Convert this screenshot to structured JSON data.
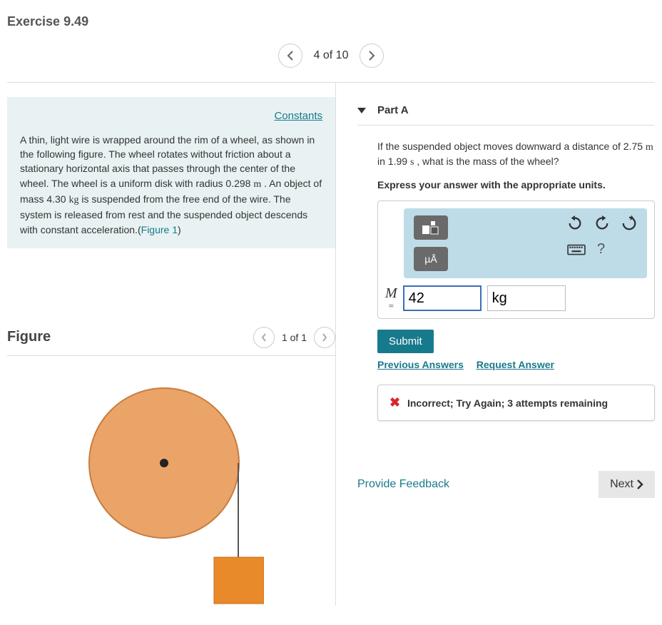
{
  "header": {
    "title": "Exercise 9.49"
  },
  "nav": {
    "position": "4 of 10"
  },
  "problem": {
    "constants_link": "Constants",
    "text_1": "A thin, light wire is wrapped around the rim of a wheel, as shown in the following figure. The wheel rotates without friction about a stationary horizontal axis that passes through the center of the wheel. The wheel is a uniform disk with radius 0.298 ",
    "unit_m1": "m",
    "text_2": " . An object of mass 4.30 ",
    "unit_kg": "kg",
    "text_3": " is suspended from the free end of the wire. The system is released from rest and the suspended object descends with constant acceleration.(",
    "figure_link": "Figure 1",
    "text_4": ")"
  },
  "figure": {
    "heading": "Figure",
    "position": "1 of 1"
  },
  "part": {
    "label": "Part A",
    "question_1": "If the suspended object moves downward a distance of 2.75 ",
    "q_unit_m": "m",
    "question_2": " in 1.99 ",
    "q_unit_s": "s",
    "question_3": " , what is the mass of the wheel?",
    "instruction": "Express your answer with the appropriate units.",
    "toolbar": {
      "units_btn": "µÅ"
    },
    "answer": {
      "var": "M",
      "eq": "=",
      "value": "42",
      "unit": "kg"
    },
    "submit": "Submit",
    "prev_answers": "Previous Answers",
    "request_answer": "Request Answer",
    "feedback": "Incorrect; Try Again; 3 attempts remaining"
  },
  "footer": {
    "provide_feedback": "Provide Feedback",
    "next": "Next"
  }
}
